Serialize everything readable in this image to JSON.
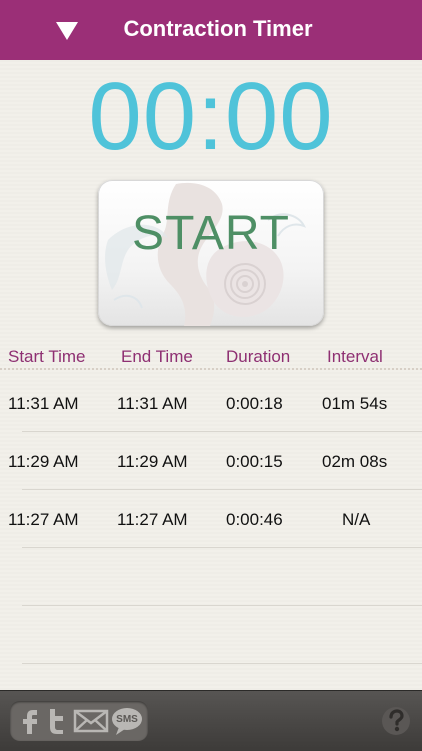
{
  "header": {
    "title": "Contraction Timer",
    "collapse_icon": "triangle-down-icon"
  },
  "timer": {
    "display": "00:00"
  },
  "start_button": {
    "label": "START"
  },
  "table": {
    "columns": [
      "Start Time",
      "End Time",
      "Duration",
      "Interval"
    ],
    "rows": [
      {
        "start": "11:31 AM",
        "end": "11:31 AM",
        "duration": "0:00:18",
        "interval": "01m 54s"
      },
      {
        "start": "11:29 AM",
        "end": "11:29 AM",
        "duration": "0:00:15",
        "interval": "02m 08s"
      },
      {
        "start": "11:27 AM",
        "end": "11:27 AM",
        "duration": "0:00:46",
        "interval": "N/A"
      }
    ]
  },
  "footer": {
    "share_icons": [
      "facebook-icon",
      "twitter-icon",
      "email-icon",
      "sms-icon"
    ],
    "sms_label": "SMS",
    "help_icon": "help-icon"
  },
  "colors": {
    "header_bg": "#9b2f77",
    "timer": "#4fc3d9",
    "start_label": "#4e8f65",
    "column_header": "#8e2f72",
    "footer_bg": "#454341"
  }
}
